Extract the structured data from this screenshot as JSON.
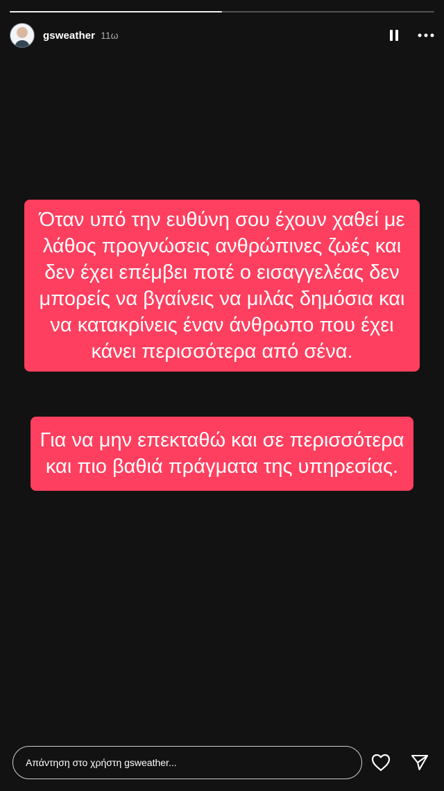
{
  "story": {
    "progress": 0.5,
    "username": "gsweather",
    "time_ago": "11ω"
  },
  "message_1": {
    "lines": [
      "Όταν υπό την  ευθύνη σου έχουν χαθεί με",
      "λάθος προγνώσεις ανθρώπινες ζωές και",
      "δεν έχει επέμβει ποτέ ο εισαγγελέας δεν",
      "μπορείς να βγαίνεις να μιλάς δημόσια  και",
      "να κατακρίνεις έναν άνθρωπο που έχει",
      "κάνει περισσότερα από σένα."
    ]
  },
  "message_2": {
    "lines": [
      "Για να μην επεκταθώ και σε περισσότερα",
      "και πιο βαθιά πράγματα της υπηρεσίας."
    ]
  },
  "reply": {
    "placeholder": "Απάντηση στο χρήστη gsweather..."
  },
  "icons": {
    "pause": "pause-icon",
    "more": "more-icon",
    "like": "heart-icon",
    "send": "send-icon"
  },
  "colors": {
    "background": "#121212",
    "message_bg": "#ff3f5f",
    "text": "#ffffff"
  }
}
